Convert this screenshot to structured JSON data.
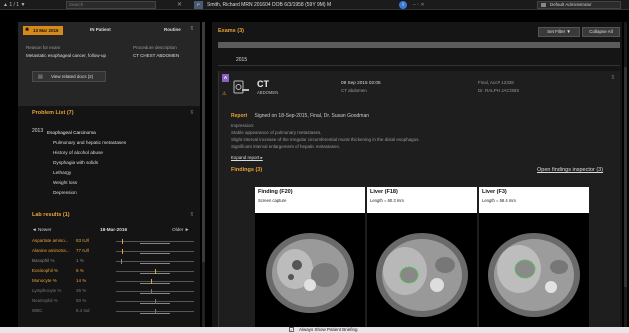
{
  "topbar": {
    "nav": "▲  1 / 1  ▼",
    "search_placeholder": "Search",
    "close_glyph": "✕",
    "patient_badge": "P",
    "patient_line": "Smith, Richard  MRN 201604  DOB 6/3/1958 (59Y 9M)  M",
    "info_glyph": "i",
    "window_controls": "–  ▫  ✕",
    "user": "Default Administrator"
  },
  "encounter": {
    "date": "13 Mar 2016",
    "type": "IN Patient",
    "priority": "Routine",
    "pin": "⊼",
    "reason_label": "Reason for exam",
    "reason_value": "Metastatic esophageal cancer, follow-up",
    "procedure_label": "Procedure description",
    "procedure_value": "CT CHEST ABDOMEN",
    "related_docs": "View related docs (2)"
  },
  "problems": {
    "title": "Problem List (7)",
    "pin": "⊼",
    "year": "2013",
    "items": [
      "Esophageal Carcinoma",
      "Pulmonary and hepatic metastases",
      "History of alcohol abuse",
      "Dysphagia with solids",
      "Lethargy",
      "Weight loss",
      "Depression"
    ]
  },
  "labs": {
    "title": "Lab results (1)",
    "pin": "⊼",
    "newer": "◄ Newer",
    "date": "18-Mar-2016",
    "older": "Older ►",
    "rows": [
      {
        "name": "Aspartate amino...",
        "value": "83 IU/l",
        "color": "#e8a23a",
        "pos": 0.08
      },
      {
        "name": "Alanine aminotra...",
        "value": "77 IU/l",
        "color": "#e8a23a",
        "pos": 0.08
      },
      {
        "name": "Basophil %",
        "value": "1 %",
        "color": "#888888",
        "pos": 0.06
      },
      {
        "name": "Eosinophil %",
        "value": "6 %",
        "color": "#e8a23a",
        "pos": 0.5
      },
      {
        "name": "Monocyte %",
        "value": "14 %",
        "color": "#e8a23a",
        "pos": 0.45
      },
      {
        "name": "Lymphocyte %",
        "value": "26 %",
        "color": "#777777",
        "pos": 0.45
      },
      {
        "name": "Neutrophil %",
        "value": "60 %",
        "color": "#777777",
        "pos": 0.5
      },
      {
        "name": "WBC",
        "value": "8.4 tsd",
        "color": "#777777",
        "pos": 0.5
      }
    ]
  },
  "main": {
    "exams_title": "Exams (3)",
    "set_filter": "Set Filter ▼",
    "collapse_all": "Collapse All",
    "year": "2015"
  },
  "exam": {
    "badge": "A",
    "alert_icon": "⚠",
    "modality": "CT",
    "body_part": "ABDOMEN",
    "date": "09 Sep 2015 02:05",
    "description": "CT abdomen",
    "status": "Final, Acc# 12328",
    "doctor": "Dr. RALPH JACOBS",
    "pin": "⊼",
    "report_label": "Report",
    "report_signed": "Signed on 18-Sep-2015, Final, Dr. Susan Goodman",
    "impression_label": "Impression:",
    "impressions": [
      "Stable appearance of pulmonary metastases.",
      "Slight interval increase of the irregular circumferential mural thickening in the distal esophagus.",
      "Significant interval enlargement of hepatic metastases."
    ],
    "expand_report": "Expand report ▸",
    "findings_label": "Findings (3)",
    "open_inspector": "Open findings inspector (3)",
    "findings": [
      {
        "title": "Finding (F20)",
        "subtitle": "Screen capture"
      },
      {
        "title": "Liver (F18)",
        "subtitle": "Length = 60.3 mm"
      },
      {
        "title": "Liver (F3)",
        "subtitle": "Length = 58.4 mm"
      }
    ]
  },
  "bottom": {
    "checkbox_mark": "✓",
    "label": "Always Show Patient Briefing"
  }
}
